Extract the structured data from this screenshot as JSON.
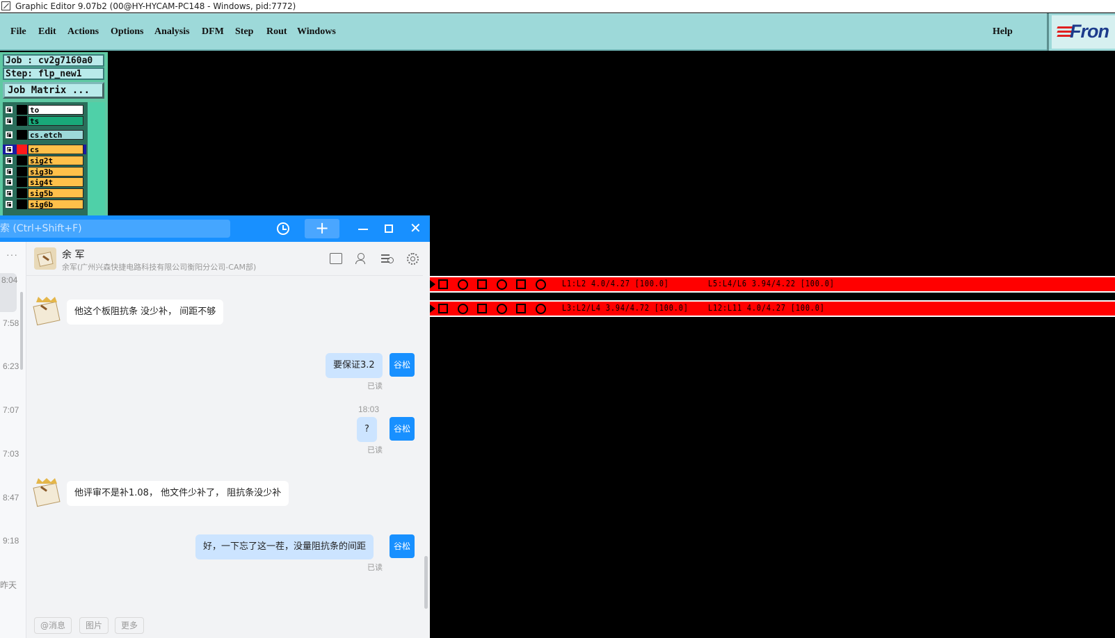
{
  "window": {
    "title": "Graphic Editor 9.07b2 (00@HY-HYCAM-PC148 - Windows, pid:7772)"
  },
  "menu": {
    "items": [
      "File",
      "Edit",
      "Actions",
      "Options",
      "Analysis",
      "DFM",
      "Step",
      "Rout",
      "Windows"
    ],
    "help": "Help",
    "logo": "Fron"
  },
  "left_panel": {
    "job": "Job : cv2g7160a0",
    "step": "Step: flp_new1",
    "job_matrix": "Job Matrix ...",
    "layers": [
      {
        "name": "to",
        "color": "#ffffff"
      },
      {
        "name": "ts",
        "color": "#19a979"
      },
      {
        "name": "cs.etch",
        "color": "#9dd9d9"
      },
      {
        "name": "cs",
        "color": "#ffc04a",
        "active": true
      },
      {
        "name": "sig2t",
        "color": "#ffc04a"
      },
      {
        "name": "sig3b",
        "color": "#ffc04a"
      },
      {
        "name": "sig4t",
        "color": "#ffc04a"
      },
      {
        "name": "sig5b",
        "color": "#ffc04a"
      },
      {
        "name": "sig6b",
        "color": "#ffc04a"
      }
    ]
  },
  "graphic": {
    "strip1_labels": [
      "L1:L2 4.0/4.27 [100.0]",
      "L5:L4/L6 3.94/4.22 [100.0]"
    ],
    "strip2_labels": [
      "L3:L2/L4 3.94/4.72 [100.0]",
      "L12:L11 4.0/4.27 [100.0]"
    ],
    "strip_color": "#ff0000"
  },
  "chat": {
    "search_placeholder": "索 (Ctrl+Shift+F)",
    "header": {
      "name": "余 军",
      "subtitle": "余军(广州兴森快捷电路科技有限公司衡阳分公司-CAM部)"
    },
    "list_times": [
      "8:04",
      "7:58",
      "6:23",
      "7:07",
      "7:03",
      "8:47",
      "9:18",
      "昨天"
    ],
    "messages": {
      "m1": "他这个板阻抗条 没少补， 间距不够",
      "m2": "要保证3.2",
      "m2_read": "已读",
      "time1": "18:03",
      "m3": "?",
      "m3_read": "已读",
      "m4": "他评审不是补1.08， 他文件少补了， 阻抗条没少补",
      "m5": "好，一下忘了这一茬，没量阻抗条的间距",
      "m5_read": "已读",
      "me_label": "谷松"
    },
    "bottom_buttons": [
      "@消息",
      "图片",
      "更多"
    ],
    "accent": "#1890ff"
  }
}
